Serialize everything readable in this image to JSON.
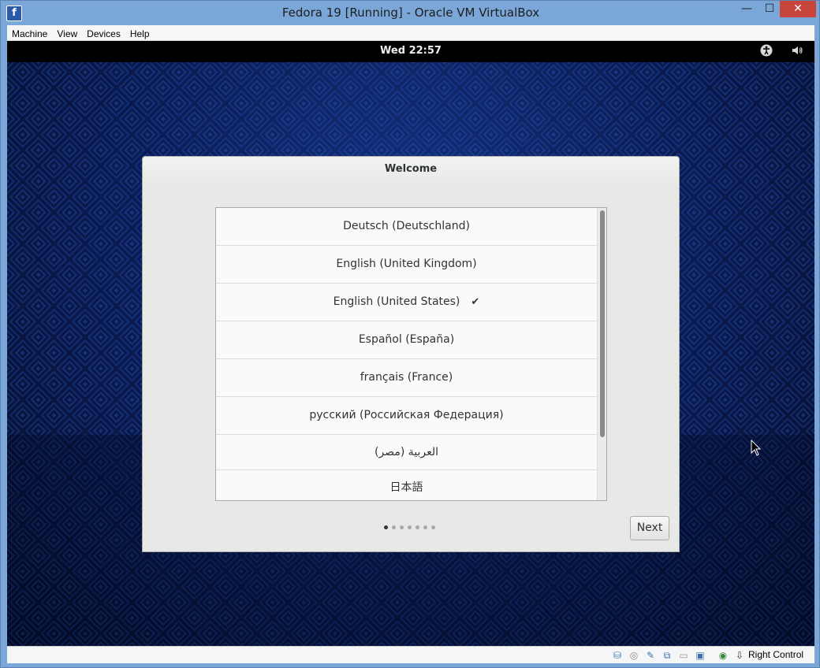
{
  "window": {
    "title": "Fedora 19 [Running] - Oracle VM VirtualBox",
    "app_icon": "fedora-icon"
  },
  "menubar": {
    "items": [
      {
        "label": "Machine"
      },
      {
        "label": "View"
      },
      {
        "label": "Devices"
      },
      {
        "label": "Help"
      }
    ]
  },
  "guest": {
    "topbar": {
      "clock": "Wed 22:57",
      "icons": [
        "accessibility-icon",
        "volume-icon"
      ]
    },
    "dialog": {
      "title": "Welcome",
      "languages": [
        {
          "label": "Deutsch (Deutschland)",
          "selected": false
        },
        {
          "label": "English (United Kingdom)",
          "selected": false
        },
        {
          "label": "English (United States)",
          "selected": true
        },
        {
          "label": "Español (España)",
          "selected": false
        },
        {
          "label": "français (France)",
          "selected": false
        },
        {
          "label": "русский (Российская Федерация)",
          "selected": false
        },
        {
          "label": "العربية (مصر)",
          "selected": false
        },
        {
          "label": "日本語",
          "selected": false
        }
      ],
      "check_mark": "✔",
      "pager": {
        "pages": 7,
        "current": 1
      },
      "next_label": "Next"
    }
  },
  "statusbar": {
    "icons": [
      "hard-disk-icon",
      "optical-drive-icon",
      "usb-icon",
      "network-icon",
      "shared-folders-icon",
      "video-capture-icon",
      "mouse-integration-icon",
      "keyboard-capture-icon"
    ],
    "host_key": "Right Control"
  },
  "colors": {
    "titlebar": "#7aa6d8",
    "close_button": "#c7453a",
    "guest_background": "#0c1d55",
    "dialog_background": "#e8e8e7"
  }
}
